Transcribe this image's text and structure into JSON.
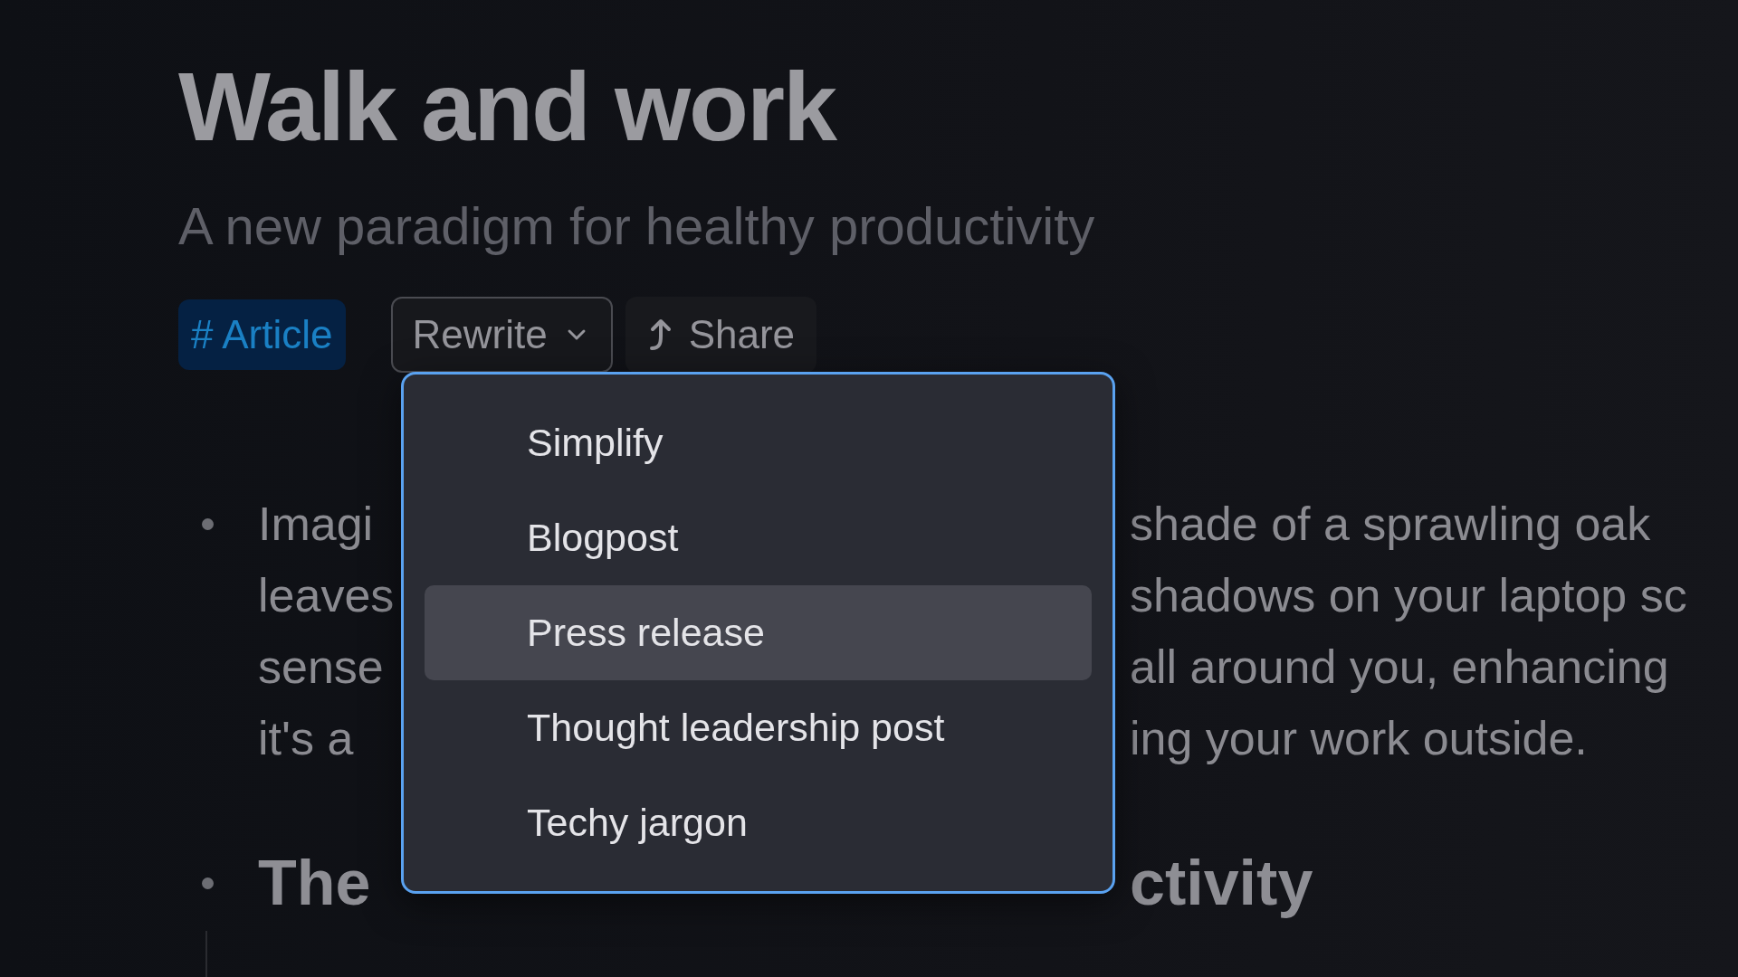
{
  "title": "Walk and work",
  "subtitle": "A new paradigm for healthy productivity",
  "tag": {
    "label": "# Article"
  },
  "actions": [
    {
      "kind": "dropdown",
      "label": "Rewrite",
      "expanded": true
    },
    {
      "kind": "share",
      "label": "Share"
    }
  ],
  "menu": {
    "items": [
      {
        "label": "Simplify",
        "selected": false
      },
      {
        "label": "Blogpost",
        "selected": false
      },
      {
        "label": "Press release",
        "selected": true
      },
      {
        "label": "Thought leadership post",
        "selected": false
      },
      {
        "label": "Techy jargon",
        "selected": false
      }
    ]
  },
  "content": [
    {
      "kind": "paragraph",
      "lines": [
        {
          "left": "Imagi",
          "right": "shade of a sprawling oak"
        },
        {
          "left": "leaves",
          "right": "shadows on your laptop sc"
        },
        {
          "left": "sense",
          "right": "all around you, enhancing"
        },
        {
          "left": "it's a",
          "right": "ing your work outside."
        }
      ]
    },
    {
      "kind": "heading",
      "lines": [
        {
          "left": "The",
          "right": "ctivity"
        }
      ]
    }
  ]
}
